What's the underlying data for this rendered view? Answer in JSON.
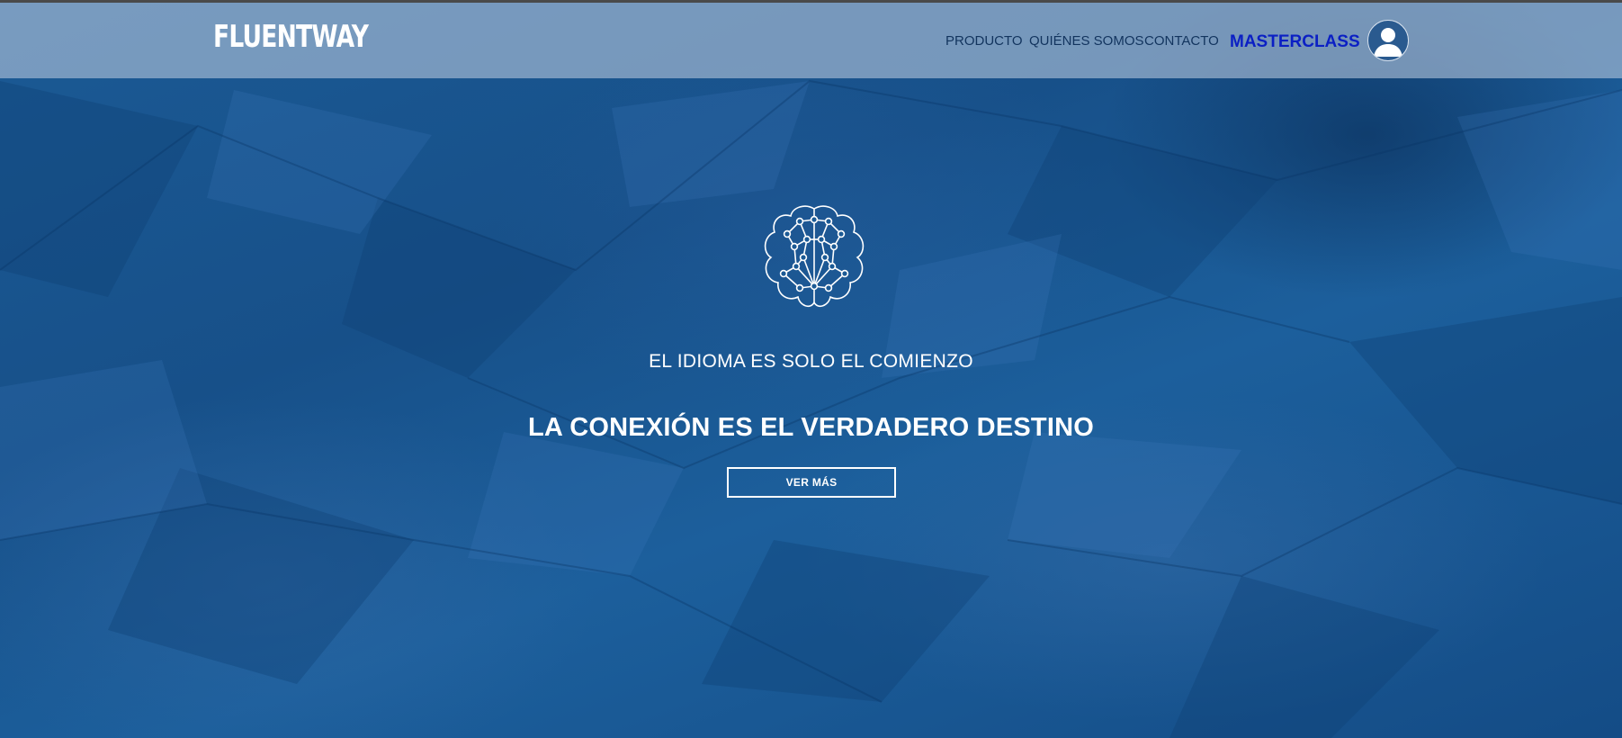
{
  "header": {
    "logo": "FLUENTWAY",
    "nav": {
      "producto": "PRODUCTO",
      "quienes_somos": "QUIÉNES SOMOS",
      "contacto": "CONTACTO",
      "masterclass": "MASTERCLASS"
    },
    "account_icon": "user-avatar-icon"
  },
  "hero": {
    "icon": "brain-network-icon",
    "tagline": "EL IDIOMA ES SOLO EL COMIENZO",
    "headline": "LA CONEXIÓN ES EL VERDADERO DESTINO",
    "cta_label": "VER MÁS"
  },
  "colors": {
    "background": "#1b5a95",
    "nav_text": "#12345e",
    "masterclass": "#0b1fc4",
    "white": "#ffffff"
  }
}
